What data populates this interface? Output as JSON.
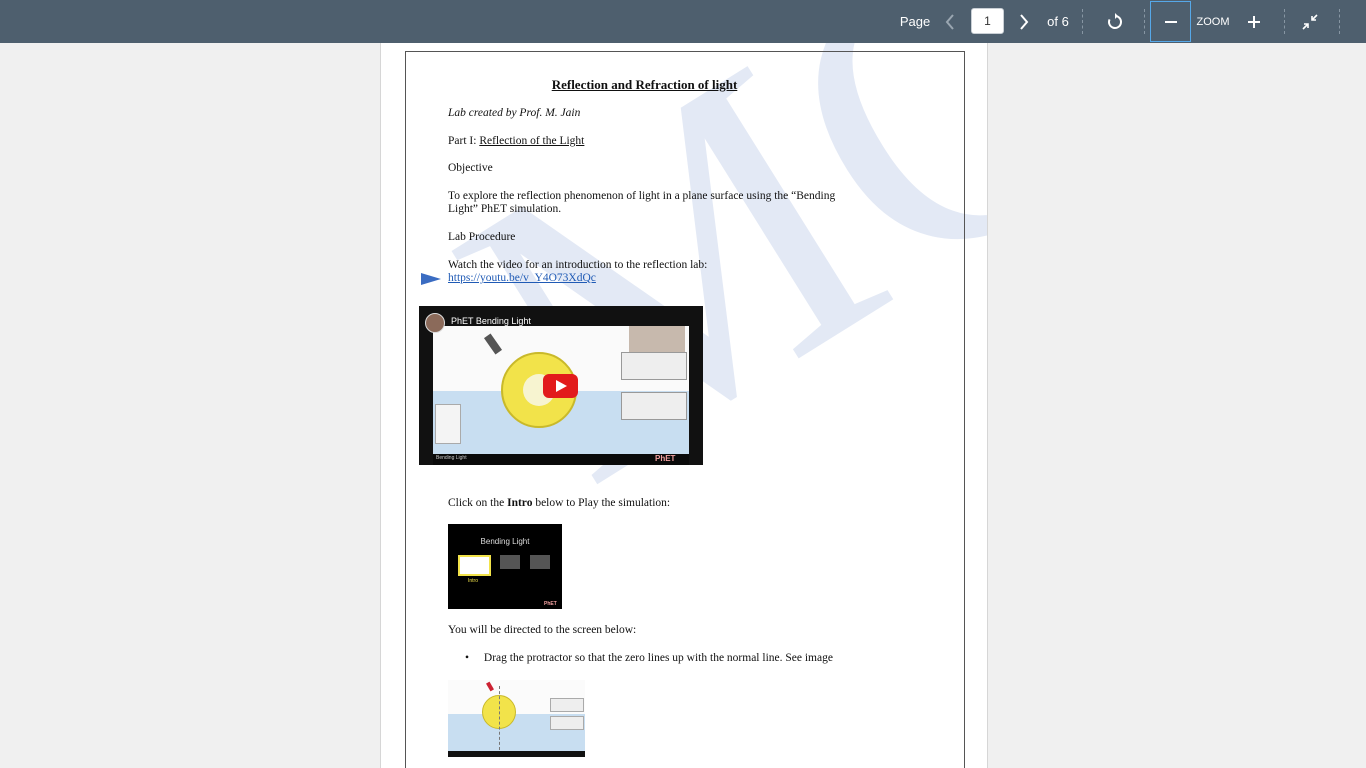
{
  "toolbar": {
    "page_label": "Page",
    "current_page": "1",
    "page_count_label": "of 6",
    "zoom_label": "ZOOM"
  },
  "document": {
    "title": "Reflection and Refraction of light",
    "author_line": "Lab created by Prof. M. Jain",
    "part_prefix": "Part I: ",
    "part_title": "Reflection of the Light",
    "objective_heading": "Objective",
    "objective_line1": "To explore the reflection phenomenon of light in a plane surface using the “Bending",
    "objective_line2": "Light” PhET simulation.",
    "procedure_heading": "Lab Procedure",
    "video_intro": "Watch the video for an introduction to the reflection lab:",
    "video_link": "https://youtu.be/v_Y4O73XdQc",
    "video_title": "PhET Bending Light",
    "video_footer_label": "Bending Light",
    "video_brand": "PhET",
    "click_prefix": "Click on the ",
    "click_bold": "Intro",
    "click_suffix": " below to Play the simulation:",
    "intro_thumb_title": "Bending Light",
    "intro_thumb_label": "Intro",
    "intro_thumb_brand": "PhET",
    "directed_text": "You will be directed to the screen below:",
    "bullet_1": "Drag the protractor so that the zero lines up with the normal line. See image",
    "watermark": "MCC"
  },
  "colors": {
    "toolbar_bg": "#4e5f6e",
    "link": "#1f5ab5",
    "focus_outline": "#56a8e8"
  }
}
